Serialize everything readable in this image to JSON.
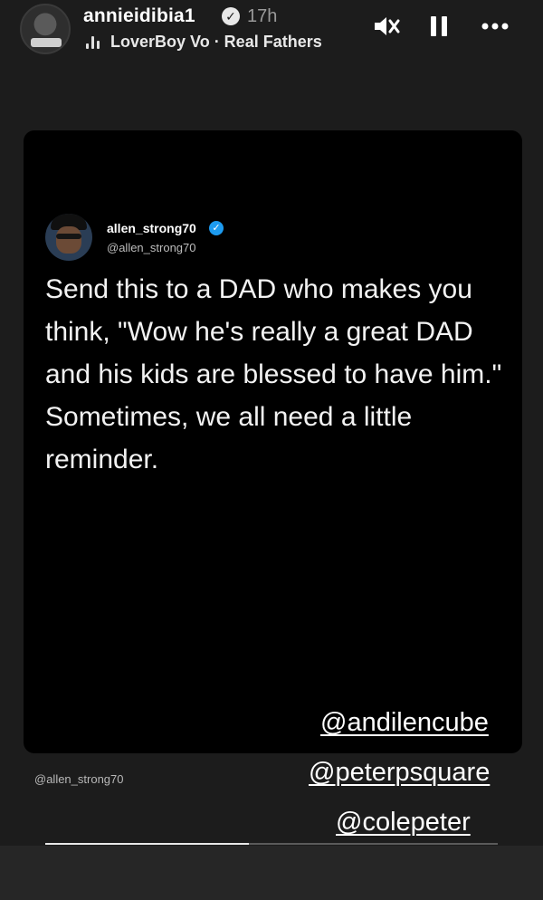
{
  "header": {
    "username": "annieidibia1",
    "timestamp": "17h",
    "music_label": "LoverBoy Vo · Real Fathers",
    "icons": [
      "avatar",
      "verified-icon",
      "music-bars-icon",
      "mute-icon",
      "pause-icon",
      "more-icon"
    ]
  },
  "tweet": {
    "name": "allen_strong70",
    "handle": "@allen_strong70",
    "text": "Send this to a DAD who makes you think, \"Wow he's really a great DAD and his kids are blessed to have him.\" Sometimes, we all need a little reminder."
  },
  "watermark": "@allen_strong70",
  "mentions": [
    "@andilencube",
    "@peterpsquare",
    "@colepeter"
  ],
  "progress": 0.45,
  "colors": {
    "background": "#1c1c1c",
    "card": "#000000",
    "verified_blue": "#1d9bf0"
  }
}
